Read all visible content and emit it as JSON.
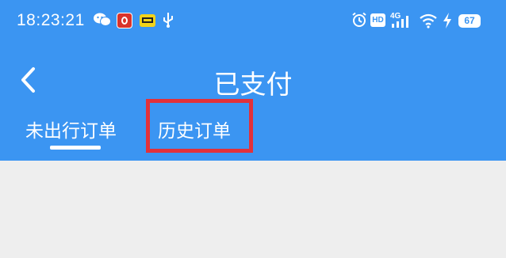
{
  "status_bar": {
    "time": "18:23:21",
    "network": "4G",
    "battery": "67",
    "icons": [
      "wechat-icon",
      "red-app-icon",
      "yellow-app-icon",
      "usb-icon",
      "alarm-icon",
      "hd-icon",
      "signal-icon",
      "wifi-icon",
      "charging-icon"
    ],
    "hd_label": "HD"
  },
  "nav": {
    "title": "已支付",
    "back_icon": "chevron-left-icon"
  },
  "tabs": [
    {
      "label": "未出行订单",
      "active": true
    },
    {
      "label": "历史订单",
      "active": false,
      "highlighted": true
    }
  ],
  "colors": {
    "header": "#3b95f2",
    "highlight": "#e2313a",
    "content_bg": "#eeeeee"
  }
}
